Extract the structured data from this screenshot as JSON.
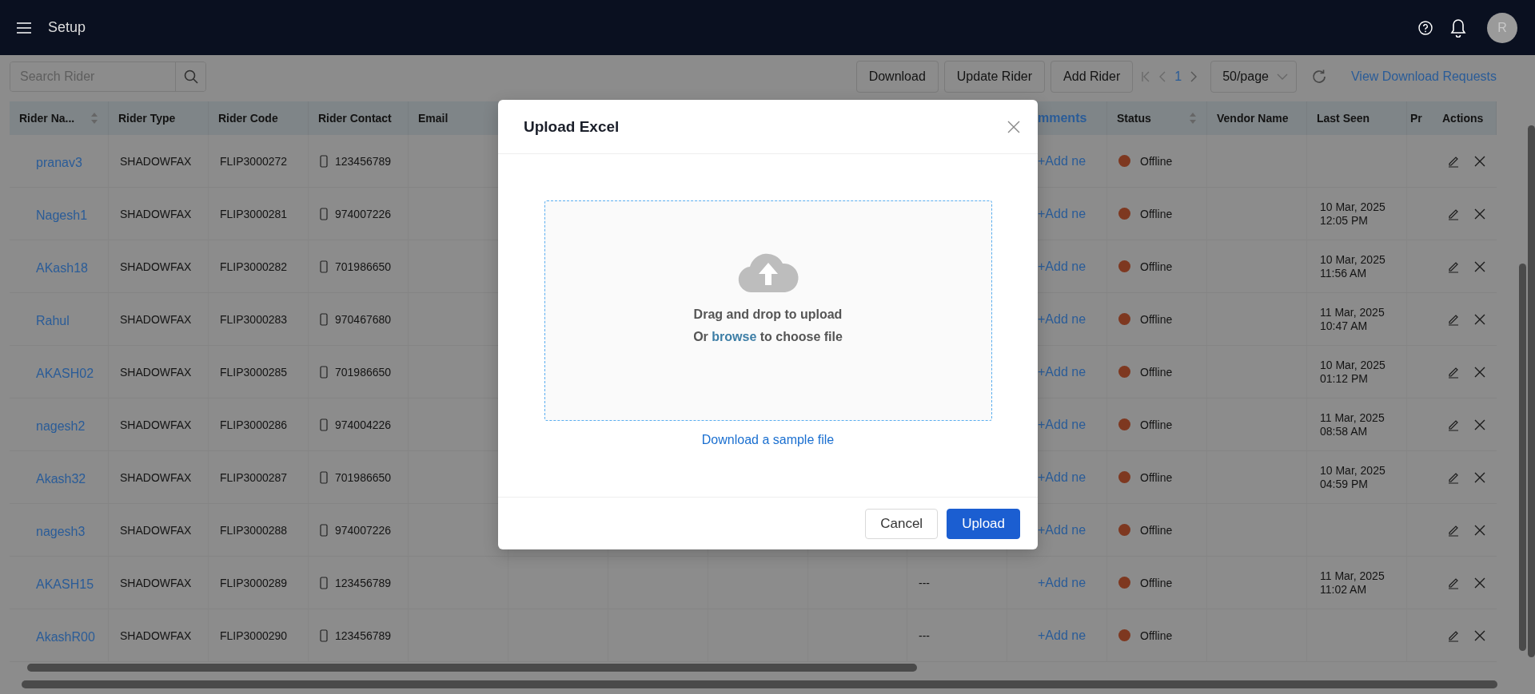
{
  "header": {
    "title": "Setup",
    "avatar": "R"
  },
  "toolbar": {
    "search": {
      "placeholder": "Search Rider"
    },
    "buttons": [
      "Download",
      "Update Rider",
      "Add Rider"
    ],
    "page": "1",
    "page_size": "50/page",
    "link": "View Download Requests"
  },
  "table": {
    "columns": [
      {
        "label": "Rider Na...",
        "sortable": true
      },
      {
        "label": "Rider Type",
        "sortable": false
      },
      {
        "label": "Rider Code",
        "sortable": false
      },
      {
        "label": "Rider Contact",
        "sortable": false
      },
      {
        "label": "Email",
        "sortable": false
      },
      {
        "label": "mments",
        "sortable": false
      },
      {
        "label": "Status",
        "sortable": true
      },
      {
        "label": "Vendor Name",
        "sortable": false
      },
      {
        "label": "Last Seen",
        "sortable": false
      },
      {
        "label": "Pr",
        "sortable": false
      },
      {
        "label": "Actions",
        "sortable": false
      }
    ],
    "rows": [
      {
        "rider_name": "pranav3",
        "rider_type": "SHADOWFAX",
        "rider_code": "FLIP3000272",
        "rider_contact": "123456789",
        "comments": "+Add ne",
        "status": "Offline",
        "color": "#7e3820"
      },
      {
        "rider_name": "Nagesh1",
        "rider_type": "SHADOWFAX",
        "rider_code": "FLIP3000281",
        "rider_contact": "974007226",
        "comments": "+Add ne",
        "status": "Offline",
        "color": "#7e3820",
        "last_seen": "10 Mar, 2025 12:05 PM"
      },
      {
        "rider_name": "AKash18",
        "rider_type": "SHADOWFAX",
        "rider_code": "FLIP3000282",
        "rider_contact": "701986650",
        "comments": "+Add ne",
        "status": "Offline",
        "color": "#7e3820",
        "last_seen": "10 Mar, 2025 11:56 AM"
      },
      {
        "rider_name": "Rahul",
        "rider_type": "SHADOWFAX",
        "rider_code": "FLIP3000283",
        "rider_contact": "970467680",
        "comments": "+Add ne",
        "status": "Offline",
        "color": "#7e3820",
        "last_seen": "11 Mar, 2025 10:47 AM"
      },
      {
        "rider_name": "AKASH02",
        "rider_type": "SHADOWFAX",
        "rider_code": "FLIP3000285",
        "rider_contact": "701986650",
        "comments": "+Add ne",
        "status": "Offline",
        "color": "#7e3820",
        "last_seen": "10 Mar, 2025 01:12 PM"
      },
      {
        "rider_name": "nagesh2",
        "rider_type": "SHADOWFAX",
        "rider_code": "FLIP3000286",
        "rider_contact": "974004226",
        "comments": "+Add ne",
        "status": "Offline",
        "color": "#7e3820",
        "last_seen": "11 Mar, 2025 08:58 AM"
      },
      {
        "rider_name": "Akash32",
        "rider_type": "SHADOWFAX",
        "rider_code": "FLIP3000287",
        "rider_contact": "701986650",
        "comments": "+Add ne",
        "status": "Offline",
        "color": "#7e3820",
        "last_seen": "10 Mar, 2025 04:59 PM"
      },
      {
        "rider_name": "nagesh3",
        "rider_type": "SHADOWFAX",
        "rider_code": "FLIP3000288",
        "rider_contact": "974007226",
        "comments": "+Add ne",
        "status": "Offline",
        "color": "#7e3820"
      },
      {
        "rider_name": "AKASH15",
        "rider_type": "SHADOWFAX",
        "rider_code": "FLIP3000289",
        "rider_contact": "123456789",
        "column_10": "---",
        "comments": "+Add ne",
        "status": "Offline",
        "color": "#7e3820",
        "last_seen": "11 Mar, 2025 11:02 AM"
      },
      {
        "rider_name": "AkashR00",
        "rider_type": "SHADOWFAX",
        "rider_code": "FLIP3000290",
        "rider_contact": "123456789",
        "column_10": "---",
        "comments": "+Add ne",
        "status": "Offline",
        "color": "#7e3820"
      }
    ]
  },
  "modal": {
    "title": "Upload Excel",
    "drop_text": "Drag and drop to upload",
    "hint": {
      "prefix": "Or ",
      "link": "browse",
      "suffix": " to choose file"
    },
    "sample_link": "Download a sample file",
    "buttons": [
      {
        "label": "Cancel",
        "primary": false
      },
      {
        "label": "Upload",
        "primary": true
      }
    ]
  }
}
